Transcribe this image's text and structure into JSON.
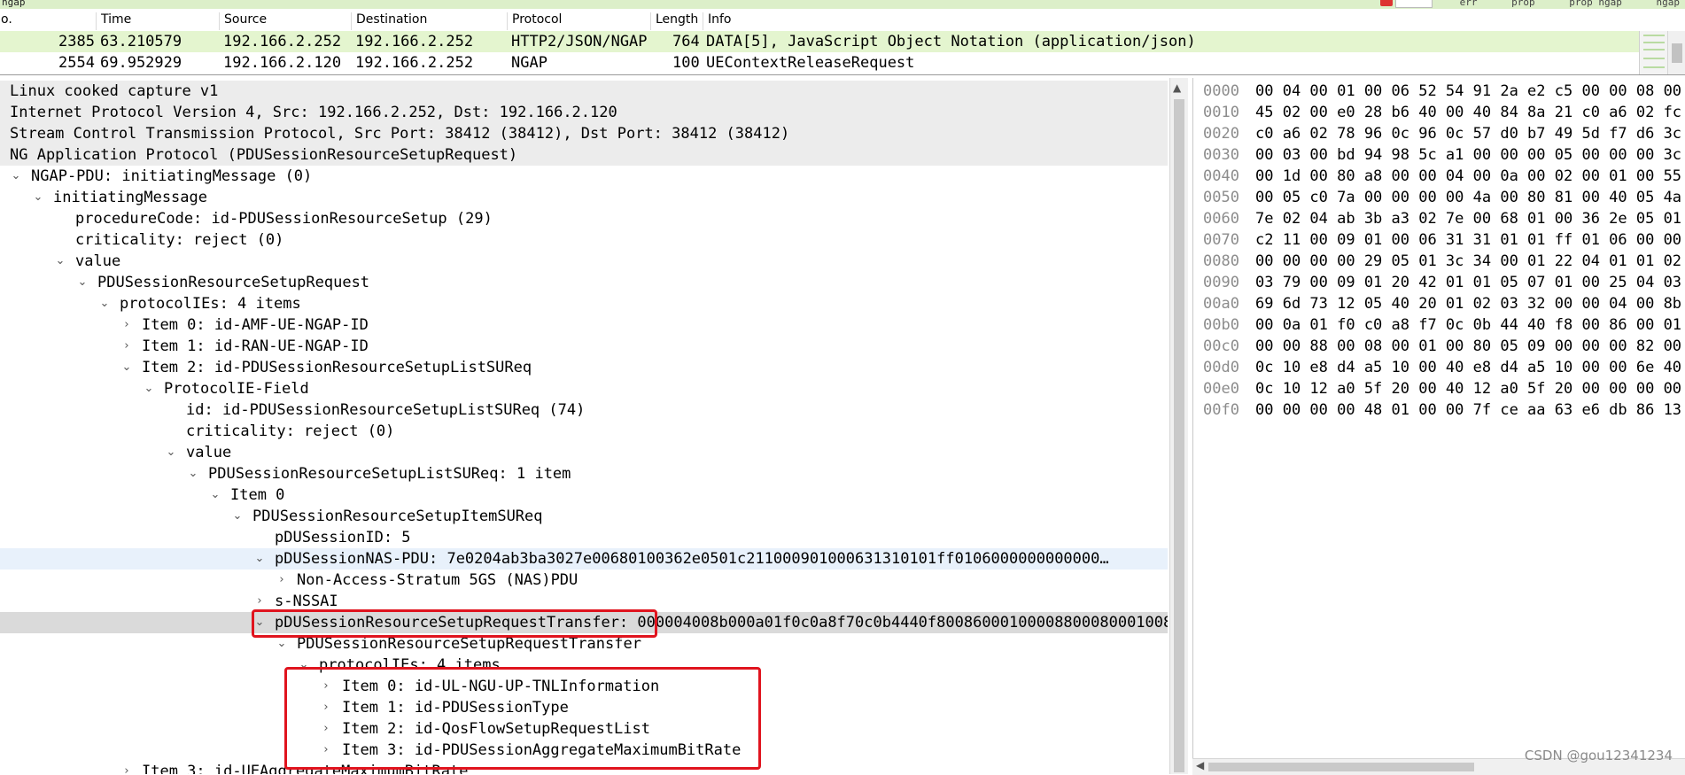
{
  "filter_bar": {
    "filter_text": "ngap",
    "buttons": [
      "err",
      "prop",
      "prop ngap",
      "ngap"
    ]
  },
  "packet_list": {
    "columns": [
      "o.",
      "Time",
      "Source",
      "Destination",
      "Protocol",
      "Length",
      "Info"
    ],
    "rows": [
      {
        "no": "2385",
        "time": "63.210579",
        "source": "192.166.2.252",
        "destination": "192.166.2.252",
        "protocol": "HTTP2/JSON/NGAP",
        "length": "764",
        "info": "DATA[5], JavaScript Object Notation (application/json)"
      },
      {
        "no": "2554",
        "time": "69.952929",
        "source": "192.166.2.120",
        "destination": "192.166.2.252",
        "protocol": "NGAP",
        "length": "100",
        "info": "UEContextReleaseRequest"
      }
    ]
  },
  "details": {
    "rows": [
      {
        "text": "Linux cooked capture v1",
        "expander": ""
      },
      {
        "text": "Internet Protocol Version 4, Src: 192.166.2.252, Dst: 192.166.2.120",
        "expander": ""
      },
      {
        "text": "Stream Control Transmission Protocol, Src Port: 38412 (38412), Dst Port: 38412 (38412)",
        "expander": ""
      },
      {
        "text": "NG Application Protocol (PDUSessionResourceSetupRequest)",
        "expander": ""
      },
      {
        "text": "NGAP-PDU: initiatingMessage (0)",
        "expander": "open"
      },
      {
        "text": "initiatingMessage",
        "expander": "open"
      },
      {
        "text": "procedureCode: id-PDUSessionResourceSetup (29)",
        "expander": ""
      },
      {
        "text": "criticality: reject (0)",
        "expander": ""
      },
      {
        "text": "value",
        "expander": "open"
      },
      {
        "text": "PDUSessionResourceSetupRequest",
        "expander": "open"
      },
      {
        "text": "protocolIEs: 4 items",
        "expander": "open"
      },
      {
        "text": "Item 0: id-AMF-UE-NGAP-ID",
        "expander": "closed"
      },
      {
        "text": "Item 1: id-RAN-UE-NGAP-ID",
        "expander": "closed"
      },
      {
        "text": "Item 2: id-PDUSessionResourceSetupListSUReq",
        "expander": "open"
      },
      {
        "text": "ProtocolIE-Field",
        "expander": "open"
      },
      {
        "text": "id: id-PDUSessionResourceSetupListSUReq (74)",
        "expander": ""
      },
      {
        "text": "criticality: reject (0)",
        "expander": ""
      },
      {
        "text": "value",
        "expander": "open"
      },
      {
        "text": "PDUSessionResourceSetupListSUReq: 1 item",
        "expander": "open"
      },
      {
        "text": "Item 0",
        "expander": "open"
      },
      {
        "text": "PDUSessionResourceSetupItemSUReq",
        "expander": "open"
      },
      {
        "text": "pDUSessionID: 5",
        "expander": ""
      },
      {
        "text": "pDUSessionNAS-PDU: 7e0204ab3ba3027e00680100362e0501c211000901000631310101ff0106000000000000…",
        "expander": "open"
      },
      {
        "text": "Non-Access-Stratum 5GS (NAS)PDU",
        "expander": "closed"
      },
      {
        "text": "s-NSSAI",
        "expander": "closed"
      },
      {
        "text": "pDUSessionResourceSetupRequestTransfer: 000004008b000a01f0c0a8f70c0b4440f800860001000088000800010080…",
        "expander": "open"
      },
      {
        "text": "PDUSessionResourceSetupRequestTransfer",
        "expander": "open"
      },
      {
        "text": "protocolIEs: 4 items",
        "expander": "open"
      },
      {
        "text": "Item 0: id-UL-NGU-UP-TNLInformation",
        "expander": "closed"
      },
      {
        "text": "Item 1: id-PDUSessionType",
        "expander": "closed"
      },
      {
        "text": "Item 2: id-QosFlowSetupRequestList",
        "expander": "closed"
      },
      {
        "text": "Item 3: id-PDUSessionAggregateMaximumBitRate",
        "expander": "closed"
      },
      {
        "text": "Item 3: id-UEAggregateMaximumBitRate",
        "expander": "closed"
      }
    ]
  },
  "hex": {
    "rows": [
      {
        "offset": "0000",
        "bytes": "00 04 00 01 00 06 52 54  91 2a e2 c5 00 00 08 00"
      },
      {
        "offset": "0010",
        "bytes": "45 02 00 e0 28 b6 40 00  40 84 8a 21 c0 a6 02 fc"
      },
      {
        "offset": "0020",
        "bytes": "c0 a6 02 78 96 0c 96 0c  57 d0 b7 49 5d f7 d6 3c"
      },
      {
        "offset": "0030",
        "bytes": "00 03 00 bd 94 98 5c a1  00 00 00 05 00 00 00 3c"
      },
      {
        "offset": "0040",
        "bytes": "00 1d 00 80 a8 00 00 04  00 0a 00 02 00 01 00 55"
      },
      {
        "offset": "0050",
        "bytes": "00 05 c0 7a 00 00 00 00  4a 00 80 81 00 40 05 4a"
      },
      {
        "offset": "0060",
        "bytes": "7e 02 04 ab 3b a3 02 7e  00 68 01 00 36 2e 05 01"
      },
      {
        "offset": "0070",
        "bytes": "c2 11 00 09 01 00 06 31  31 01 01 ff 01 06 00 00"
      },
      {
        "offset": "0080",
        "bytes": "00 00 00 00 29 05 01 3c  34 00 01 22 04 01 01 02"
      },
      {
        "offset": "0090",
        "bytes": "03 79 00 09 01 20 42 01  01 05 07 01 00 25 04 03"
      },
      {
        "offset": "00a0",
        "bytes": "69 6d 73 12 05 40 20 01  02 03 32 00 00 04 00 8b"
      },
      {
        "offset": "00b0",
        "bytes": "00 0a 01 f0 c0 a8 f7 0c  0b 44 40 f8 00 86 00 01"
      },
      {
        "offset": "00c0",
        "bytes": "00 00 88 00 08 00 01 00  80 05 09 00 00 00 82 00"
      },
      {
        "offset": "00d0",
        "bytes": "0c 10 e8 d4 a5 10 00 40  e8 d4 a5 10 00 00 6e 40"
      },
      {
        "offset": "00e0",
        "bytes": "0c 10 12 a0 5f 20 00 40  12 a0 5f 20 00 00 00 00"
      },
      {
        "offset": "00f0",
        "bytes": "00 00 00 00 48 01 00 00  7f ce aa 63 e6 db 86 13"
      }
    ]
  },
  "watermark": "CSDN @gou12341234"
}
